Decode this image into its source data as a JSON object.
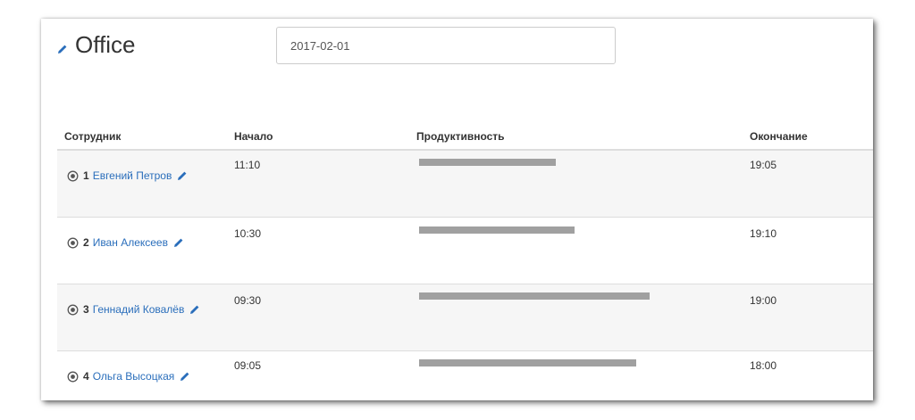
{
  "header": {
    "title": "Office",
    "date_value": "2017-02-01"
  },
  "columns": {
    "employee": "Сотрудник",
    "start": "Начало",
    "productivity": "Продуктивность",
    "end": "Окончание"
  },
  "rows": [
    {
      "num": "1",
      "name": "Евгений Петров",
      "start": "11:10",
      "end": "19:05",
      "productivity": 0.51
    },
    {
      "num": "2",
      "name": "Иван Алексеев",
      "start": "10:30",
      "end": "19:10",
      "productivity": 0.58
    },
    {
      "num": "3",
      "name": "Геннадий Ковалёв",
      "start": "09:30",
      "end": "19:00",
      "productivity": 0.86
    },
    {
      "num": "4",
      "name": "Ольга Высоцкая",
      "start": "09:05",
      "end": "18:00",
      "productivity": 0.81
    }
  ],
  "colors": {
    "link": "#2a6ebb",
    "bar": "#a0a0a0",
    "stripe": "#f6f6f6"
  },
  "icons": {
    "title": "pencil-icon",
    "row_marker": "radio-icon",
    "row_edit": "pencil-icon"
  }
}
